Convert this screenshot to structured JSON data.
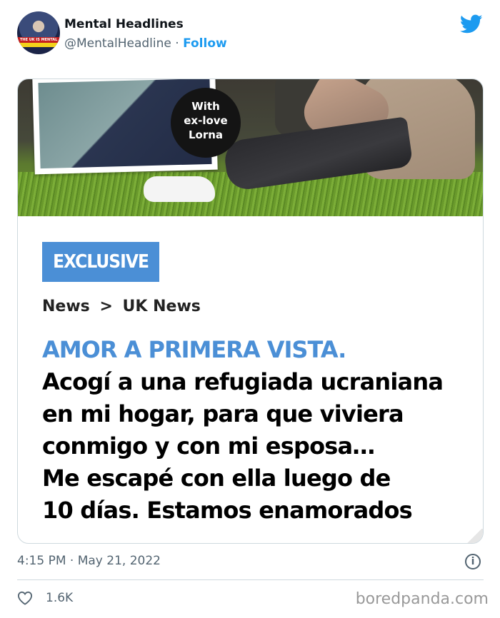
{
  "user": {
    "name": "Mental Headlines",
    "handle": "@MentalHeadline",
    "separator": "·",
    "follow_label": "Follow",
    "avatar_text": "THE UK IS MENTAL"
  },
  "card": {
    "photo_badge": [
      "With",
      "ex-love",
      "Lorna"
    ],
    "exclusive_label": "EXCLUSIVE",
    "breadcrumb": {
      "first": "News",
      "separator": ">",
      "second": "UK News"
    },
    "kicker": "AMOR A PRIMERA VISTA.",
    "headline_lines": [
      "Acogí a una refugiada ucraniana",
      "en mi hogar, para que viviera",
      "conmigo y con mi esposa…",
      "Me escapé con ella luego de",
      "10 días. Estamos enamorados"
    ]
  },
  "meta": {
    "timestamp": "4:15 PM · May 21, 2022",
    "info_icon": "i",
    "like_count": "1.6K"
  },
  "watermark": "boredpanda.com",
  "colors": {
    "accent": "#1d9bf0",
    "exclusive_bg": "#4b8fd6",
    "kicker": "#4b8fd6",
    "muted": "#536471"
  },
  "icons": {
    "platform": "twitter-bird-icon",
    "info": "info-icon",
    "like": "heart-icon"
  }
}
